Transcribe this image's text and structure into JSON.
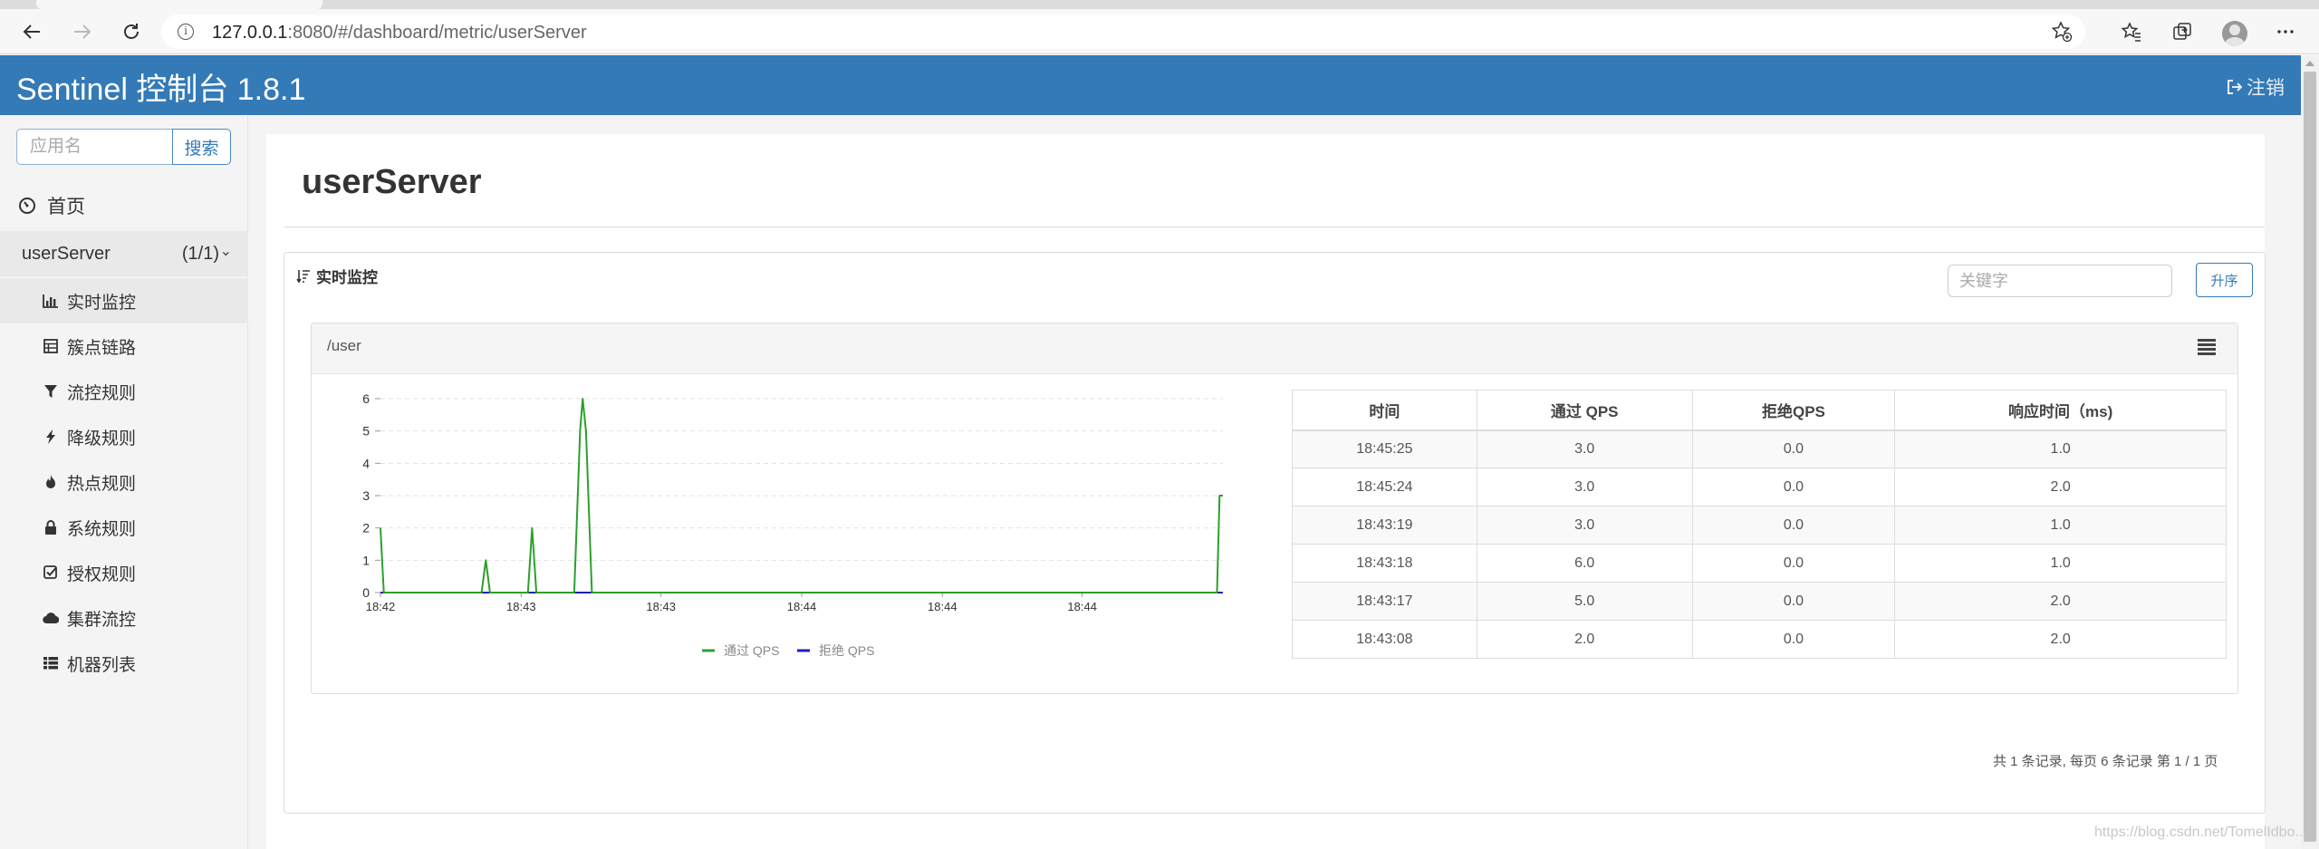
{
  "browser": {
    "url_host": "127.0.0.1",
    "url_rest": ":8080/#/dashboard/metric/userServer"
  },
  "header": {
    "brand": "Sentinel 控制台 1.8.1",
    "logout_label": "注销"
  },
  "sidebar": {
    "search_placeholder": "应用名",
    "search_button": "搜索",
    "home_label": "首页",
    "app_name": "userServer",
    "app_count": "(1/1)",
    "items": [
      {
        "label": "实时监控",
        "icon": "bar-chart-icon"
      },
      {
        "label": "簇点链路",
        "icon": "list-table-icon"
      },
      {
        "label": "流控规则",
        "icon": "filter-icon"
      },
      {
        "label": "降级规则",
        "icon": "flash-icon"
      },
      {
        "label": "热点规则",
        "icon": "fire-icon"
      },
      {
        "label": "系统规则",
        "icon": "lock-icon"
      },
      {
        "label": "授权规则",
        "icon": "check-icon"
      },
      {
        "label": "集群流控",
        "icon": "cloud-icon"
      },
      {
        "label": "机器列表",
        "icon": "th-list-icon"
      }
    ]
  },
  "main": {
    "title": "userServer",
    "panel_title": "实时监控",
    "keyword_placeholder": "关键字",
    "sort_button": "升序",
    "resource_name": "/user",
    "pager": "共 1 条记录, 每页 6 条记录 第 1 / 1 页",
    "watermark": "https://blog.csdn.net/TomelIdbo..."
  },
  "table": {
    "headers": [
      "时间",
      "通过 QPS",
      "拒绝QPS",
      "响应时间（ms)"
    ],
    "rows": [
      [
        "18:45:25",
        "3.0",
        "0.0",
        "1.0"
      ],
      [
        "18:45:24",
        "3.0",
        "0.0",
        "2.0"
      ],
      [
        "18:43:19",
        "3.0",
        "0.0",
        "1.0"
      ],
      [
        "18:43:18",
        "6.0",
        "0.0",
        "1.0"
      ],
      [
        "18:43:17",
        "5.0",
        "0.0",
        "2.0"
      ],
      [
        "18:43:08",
        "2.0",
        "0.0",
        "2.0"
      ]
    ]
  },
  "chart_data": {
    "type": "line",
    "x_tick_labels": [
      "18:42",
      "18:43",
      "18:43",
      "18:44",
      "18:44",
      "18:44"
    ],
    "x_tick_positions": [
      0.0,
      0.167,
      0.333,
      0.5,
      0.667,
      0.833
    ],
    "ylim": [
      0,
      6
    ],
    "y_ticks": [
      0,
      1,
      2,
      3,
      4,
      5,
      6
    ],
    "grid": true,
    "legend_placement": "bottom-center",
    "series": [
      {
        "name": "通过 QPS",
        "color": "#2ca02c",
        "points": [
          [
            0.0,
            2
          ],
          [
            0.004,
            0
          ],
          [
            0.12,
            0
          ],
          [
            0.125,
            1
          ],
          [
            0.13,
            0
          ],
          [
            0.175,
            0
          ],
          [
            0.18,
            2
          ],
          [
            0.185,
            0
          ],
          [
            0.23,
            0
          ],
          [
            0.237,
            5
          ],
          [
            0.24,
            6
          ],
          [
            0.244,
            5
          ],
          [
            0.251,
            0
          ],
          [
            0.993,
            0
          ],
          [
            0.996,
            3
          ],
          [
            1.0,
            3
          ]
        ]
      },
      {
        "name": "拒绝 QPS",
        "color": "#1f1fbf",
        "points": [
          [
            0.0,
            0
          ],
          [
            1.0,
            0
          ]
        ]
      }
    ]
  }
}
